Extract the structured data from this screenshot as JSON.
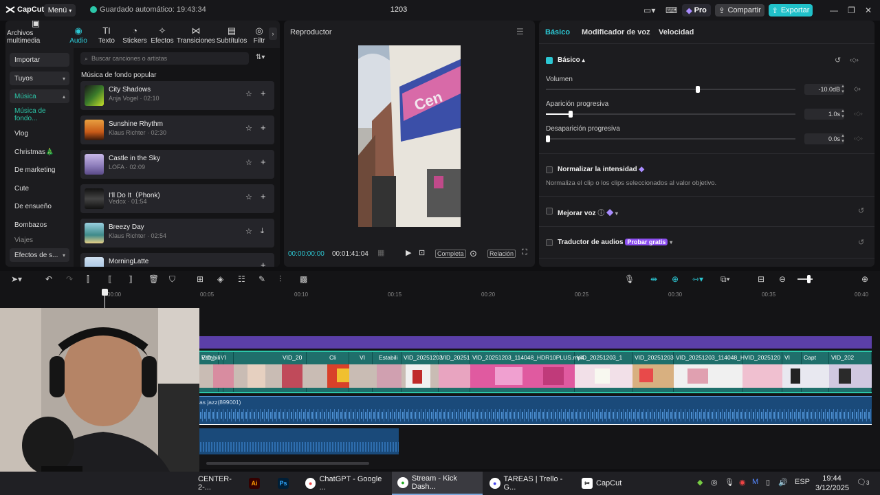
{
  "titlebar": {
    "app_name": "CapCut",
    "menu_label": "Menú",
    "autosave": "Guardado automático: 19:43:34",
    "project_title": "1203",
    "pro_label": "Pro",
    "share_label": "Compartir",
    "export_label": "Exportar"
  },
  "media_tools": [
    {
      "label": "Archivos multimedia",
      "icon": "media-icon"
    },
    {
      "label": "Audio",
      "icon": "audio-icon",
      "active": true
    },
    {
      "label": "Texto",
      "icon": "text-icon"
    },
    {
      "label": "Stickers",
      "icon": "sticker-icon"
    },
    {
      "label": "Efectos",
      "icon": "effects-icon"
    },
    {
      "label": "Transiciones",
      "icon": "transitions-icon"
    },
    {
      "label": "Subtítulos",
      "icon": "subtitles-icon"
    },
    {
      "label": "Filtr",
      "icon": "filters-icon"
    }
  ],
  "sidebar": {
    "items": [
      {
        "label": "Importar"
      },
      {
        "label": "Tuyos"
      },
      {
        "label": "Música"
      },
      {
        "label": "Música de fondo..."
      },
      {
        "label": "Vlog"
      },
      {
        "label": "Christmas🎄"
      },
      {
        "label": "De marketing"
      },
      {
        "label": "Cute"
      },
      {
        "label": "De ensueño"
      },
      {
        "label": "Bombazos"
      },
      {
        "label": "Viajes"
      },
      {
        "label": "Efectos de s..."
      }
    ]
  },
  "library": {
    "search_placeholder": "Buscar canciones o artistas",
    "section_title": "Música de fondo popular",
    "tracks": [
      {
        "title": "City Shadows",
        "meta": "Anja Vogel · 02:10",
        "color": "#3a7a2a"
      },
      {
        "title": "Sunshine Rhythm",
        "meta": "Klaus Richter · 02:30",
        "color": "#c85a18"
      },
      {
        "title": "Castle in the Sky",
        "meta": "LOFA · 02:09",
        "color": "#8a7ab8"
      },
      {
        "title": "I'll Do It（Phonk)",
        "meta": "Vedox · 01:54",
        "color": "#222222"
      },
      {
        "title": "Breezy Day",
        "meta": "Klaus Richter · 02:54",
        "color": "#3e8a8a"
      },
      {
        "title": "MorningLatte",
        "meta": "",
        "color": "#8ab0d8"
      }
    ]
  },
  "player": {
    "title": "Reproductor",
    "current_time": "00:00:00:00",
    "duration": "00:01:41:04",
    "full_label": "Completa",
    "ratio_label": "Relación"
  },
  "details": {
    "tabs": [
      "Básico",
      "Modificador de voz",
      "Velocidad"
    ],
    "basic_label": "Básico",
    "volume_label": "Volumen",
    "volume_value": "-10.0dB",
    "fadein_label": "Aparición progresiva",
    "fadein_value": "1.0s",
    "fadeout_label": "Desaparición progresiva",
    "fadeout_value": "0.0s",
    "normalize_label": "Normalizar la intensidad",
    "normalize_desc": "Normaliza el clip o los clips seleccionados al valor objetivo.",
    "enhance_label": "Mejorar voz",
    "translator_label": "Traductor de audios",
    "try_free": "Probar gratis",
    "volume_level": 0.61,
    "fadein_level": 0.1,
    "fadeout_level": 0.0
  },
  "timeline": {
    "ruler": [
      "00:00",
      "00:05",
      "00:10",
      "00:15",
      "00:20",
      "00:25",
      "00:30",
      "00:35",
      "00:40"
    ],
    "clips": [
      {
        "name": "Estabili"
      },
      {
        "name": "VI"
      },
      {
        "name": "VID_"
      },
      {
        "name": "VID_20"
      },
      {
        "name": "Cli"
      },
      {
        "name": "VI"
      },
      {
        "name": "Estabili"
      },
      {
        "name": "VID_20251203"
      },
      {
        "name": "VID_20251"
      },
      {
        "name": "VID_20251203_114048_HDR10PLUS.mp4"
      },
      {
        "name": "VID_20251203_1"
      },
      {
        "name": "VID_20251203"
      },
      {
        "name": "VID_20251203_114048_H"
      },
      {
        "name": "VID_2025120"
      },
      {
        "name": "VI"
      },
      {
        "name": "Capt"
      },
      {
        "name": "VID_202"
      }
    ],
    "audio_label": "as jazz(899001)"
  },
  "taskbar": {
    "items": [
      {
        "label": "CENTER-2-..."
      },
      {
        "label": "Ai"
      },
      {
        "label": "Ps"
      },
      {
        "label": "ChatGPT - Google ..."
      },
      {
        "label": "Stream - Kick Dash..."
      },
      {
        "label": "TAREAS | Trello - G..."
      },
      {
        "label": "CapCut"
      }
    ],
    "language": "ESP",
    "time": "19:44",
    "date": "3/12/2025",
    "notif_count": "3"
  },
  "colors": {
    "accent": "#2cc7d3",
    "export": "#20c1c9",
    "video_track": "#1f6f6b",
    "audio_track": "#1a4a7a",
    "purple_track": "#5b3fa8"
  }
}
